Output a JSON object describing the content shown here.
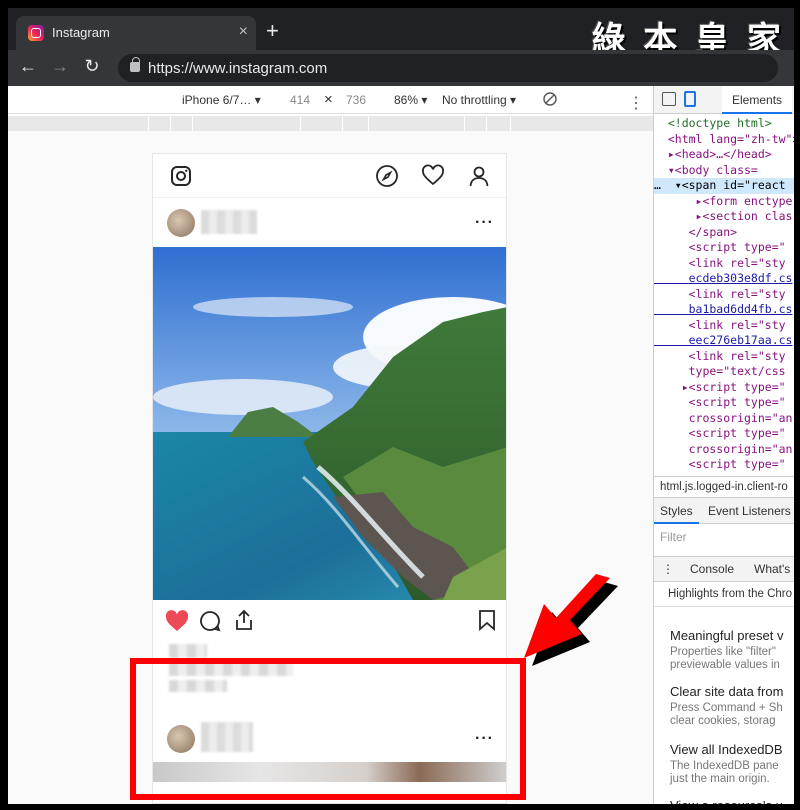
{
  "browser": {
    "tab_title": "Instagram",
    "tab_close": "×",
    "new_tab": "+",
    "url": "https://www.instagram.com",
    "watermark": "綠 本 皇 家"
  },
  "device_toolbar": {
    "device": "iPhone 6/7… ▾",
    "width": "414",
    "times": "×",
    "height": "736",
    "zoom": "86% ▾",
    "throttling": "No throttling ▾",
    "more": "⋮"
  },
  "instagram": {
    "more_dots": "···",
    "photo_description": "Coastal mountains and sea"
  },
  "devtools": {
    "elements_tab": "Elements",
    "dom_lines": [
      {
        "cls": "cm",
        "text": "  <!doctype html>"
      },
      {
        "cls": "",
        "text": "  <html lang=\"zh-tw\">"
      },
      {
        "cls": "",
        "text": "  ▸<head>…</head>"
      },
      {
        "cls": "",
        "text": "  ▾<body class="
      },
      {
        "cls": "sel",
        "text": "…  ▾<span id=\"react"
      },
      {
        "cls": "",
        "text": "      ▸<form enctype"
      },
      {
        "cls": "",
        "text": "      ▸<section clas"
      },
      {
        "cls": "",
        "text": "     </span>"
      },
      {
        "cls": "",
        "text": "     <script type=\""
      },
      {
        "cls": "",
        "text": "     <link rel=\"sty"
      },
      {
        "cls": "lnk",
        "text": "     ecdeb303e8df.cs"
      },
      {
        "cls": "",
        "text": "     <link rel=\"sty"
      },
      {
        "cls": "lnk",
        "text": "     ba1bad6dd4fb.cs"
      },
      {
        "cls": "",
        "text": "     <link rel=\"sty"
      },
      {
        "cls": "lnk",
        "text": "     eec276eb17aa.cs"
      },
      {
        "cls": "",
        "text": "     <link rel=\"sty"
      },
      {
        "cls": "",
        "text": "     type=\"text/css"
      },
      {
        "cls": "",
        "text": "    ▸<script type=\""
      },
      {
        "cls": "",
        "text": "     <script type=\""
      },
      {
        "cls": "",
        "text": "     crossorigin=\"an"
      },
      {
        "cls": "",
        "text": "     <script type=\""
      },
      {
        "cls": "",
        "text": "     crossorigin=\"an"
      },
      {
        "cls": "",
        "text": "     <script type=\""
      }
    ],
    "breadcrumb": "html.js.logged-in.client-ro",
    "styles_tab": "Styles",
    "event_listeners_tab": "Event Listeners",
    "filter_placeholder": "Filter",
    "drawer_more": "⋮",
    "console_tab": "Console",
    "whats_new_tab": "What's",
    "highlights": "Highlights from the Chro",
    "whats_new": [
      {
        "title": "Meaningful preset v",
        "body": [
          "Properties like \"filter\"",
          "previewable values in"
        ]
      },
      {
        "title": "Clear site data from",
        "body": [
          "Press Command + Sh",
          "clear cookies, storag"
        ]
      },
      {
        "title": "View all IndexedDB",
        "body": [
          "The IndexedDB pane",
          "just the main origin."
        ]
      },
      {
        "title": "View a resource's u",
        "body": []
      }
    ]
  }
}
